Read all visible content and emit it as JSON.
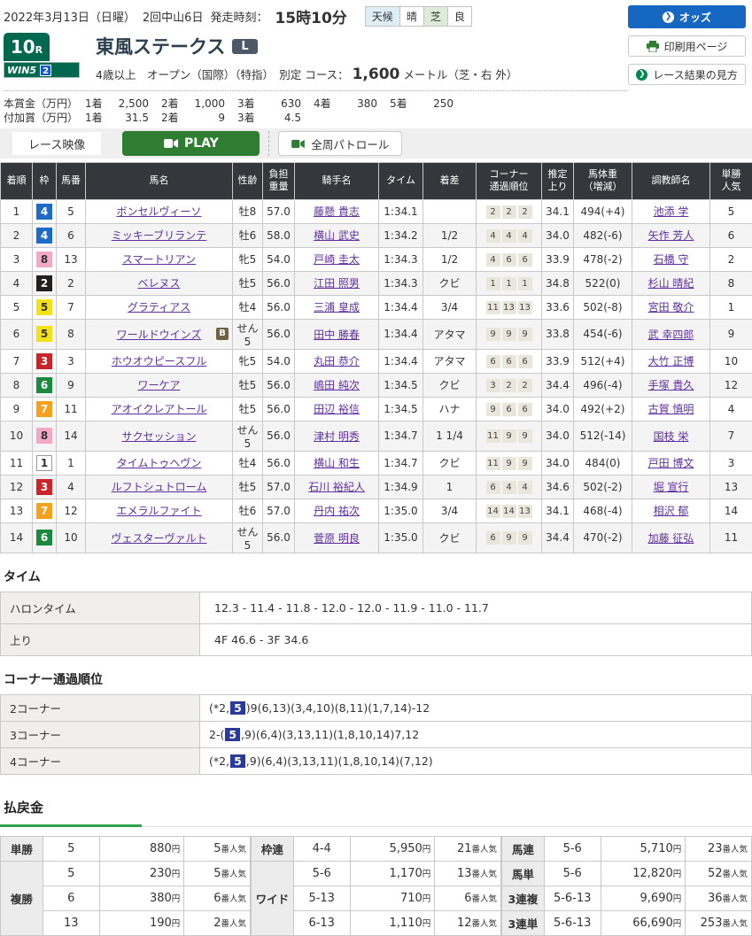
{
  "header": {
    "date": "2022年3月13日（日曜）",
    "meeting": "2回中山6日",
    "start_label": "発走時刻：",
    "start_time": "15時10分",
    "weather_label": "天候",
    "weather_value": "晴",
    "turf_label": "芝",
    "turf_value": "良",
    "buttons": {
      "odds": "オッズ",
      "print": "印刷用ページ",
      "guide": "レース結果の見方"
    }
  },
  "race": {
    "number": "10",
    "number_suffix": "R",
    "win5_label": "WIN5",
    "win5_num": "2",
    "title": "東風ステークス",
    "grade": "L",
    "conditions": "4歳以上　オープン（国際）（特指）　別定",
    "course_label": "コース：",
    "distance": "1,600",
    "course_detail": "メートル（芝・右 外）"
  },
  "prizes": {
    "main": {
      "label": "本賞金（万円）",
      "items": [
        [
          "1着",
          "2,500"
        ],
        [
          "2着",
          "1,000"
        ],
        [
          "3着",
          "630"
        ],
        [
          "4着",
          "380"
        ],
        [
          "5着",
          "250"
        ]
      ]
    },
    "added": {
      "label": "付加賞（万円）",
      "items": [
        [
          "1着",
          "31.5"
        ],
        [
          "2着",
          "9"
        ],
        [
          "3着",
          "4.5"
        ]
      ]
    }
  },
  "video": {
    "race_video": "レース映像",
    "play": "PLAY",
    "patrol": "全周パトロール"
  },
  "results": {
    "headers": [
      "着順",
      "枠",
      "馬番",
      "馬名",
      "性齢",
      "負担\n重量",
      "騎手名",
      "タイム",
      "着差",
      "コーナー\n通過順位",
      "推定\n上り",
      "馬体重\n（増減）",
      "調教師名",
      "単勝\n人気"
    ],
    "rows": [
      {
        "pos": "1",
        "frame": "4",
        "fc": "blue",
        "num": "5",
        "name": "ボンセルヴィーソ",
        "b": false,
        "sa": "牡8",
        "wt": "57.0",
        "jockey": "藤懸 貴志",
        "time": "1:34.1",
        "margin": "",
        "corners": [
          "2",
          "2",
          "2"
        ],
        "agari": "34.1",
        "bw": "494(+4)",
        "trainer": "池添 学",
        "fav": "5"
      },
      {
        "pos": "2",
        "frame": "4",
        "fc": "blue",
        "num": "6",
        "name": "ミッキーブリランテ",
        "b": false,
        "sa": "牡6",
        "wt": "58.0",
        "jockey": "横山 武史",
        "time": "1:34.2",
        "margin": "1/2",
        "corners": [
          "4",
          "4",
          "4"
        ],
        "agari": "34.0",
        "bw": "482(-6)",
        "trainer": "矢作 芳人",
        "fav": "6"
      },
      {
        "pos": "3",
        "frame": "8",
        "fc": "pink",
        "num": "13",
        "name": "スマートリアン",
        "b": false,
        "sa": "牝5",
        "wt": "54.0",
        "jockey": "戸崎 圭太",
        "time": "1:34.3",
        "margin": "1/2",
        "corners": [
          "4",
          "6",
          "6"
        ],
        "agari": "33.9",
        "bw": "478(-2)",
        "trainer": "石橋 守",
        "fav": "2"
      },
      {
        "pos": "4",
        "frame": "2",
        "fc": "black",
        "num": "2",
        "name": "ベレヌス",
        "b": false,
        "sa": "牡5",
        "wt": "56.0",
        "jockey": "江田 照男",
        "time": "1:34.3",
        "margin": "クビ",
        "corners": [
          "1",
          "1",
          "1"
        ],
        "agari": "34.8",
        "bw": "522(0)",
        "trainer": "杉山 晴紀",
        "fav": "8"
      },
      {
        "pos": "5",
        "frame": "5",
        "fc": "yellow",
        "num": "7",
        "name": "グラティアス",
        "b": false,
        "sa": "牡4",
        "wt": "56.0",
        "jockey": "三浦 皇成",
        "time": "1:34.4",
        "margin": "3/4",
        "corners": [
          "11",
          "13",
          "13"
        ],
        "agari": "33.6",
        "bw": "502(-8)",
        "trainer": "宮田 敬介",
        "fav": "1"
      },
      {
        "pos": "6",
        "frame": "5",
        "fc": "yellow",
        "num": "8",
        "name": "ワールドウインズ",
        "b": true,
        "sa": "せん5",
        "wt": "56.0",
        "jockey": "田中 勝春",
        "time": "1:34.4",
        "margin": "アタマ",
        "corners": [
          "9",
          "9",
          "9"
        ],
        "agari": "33.8",
        "bw": "454(-6)",
        "trainer": "武 幸四郎",
        "fav": "9"
      },
      {
        "pos": "7",
        "frame": "3",
        "fc": "red",
        "num": "3",
        "name": "ホウオウピースフル",
        "b": false,
        "sa": "牝5",
        "wt": "54.0",
        "jockey": "丸田 恭介",
        "time": "1:34.4",
        "margin": "アタマ",
        "corners": [
          "6",
          "6",
          "6"
        ],
        "agari": "33.9",
        "bw": "512(+4)",
        "trainer": "大竹 正博",
        "fav": "10"
      },
      {
        "pos": "8",
        "frame": "6",
        "fc": "green",
        "num": "9",
        "name": "ワーケア",
        "b": false,
        "sa": "牡5",
        "wt": "56.0",
        "jockey": "嶋田 純次",
        "time": "1:34.5",
        "margin": "クビ",
        "corners": [
          "3",
          "2",
          "2"
        ],
        "agari": "34.4",
        "bw": "496(-4)",
        "trainer": "手塚 貴久",
        "fav": "12"
      },
      {
        "pos": "9",
        "frame": "7",
        "fc": "orange",
        "num": "11",
        "name": "アオイクレアトール",
        "b": false,
        "sa": "牡5",
        "wt": "56.0",
        "jockey": "田辺 裕信",
        "time": "1:34.5",
        "margin": "ハナ",
        "corners": [
          "9",
          "6",
          "6"
        ],
        "agari": "34.0",
        "bw": "492(+2)",
        "trainer": "古賀 慎明",
        "fav": "4"
      },
      {
        "pos": "10",
        "frame": "8",
        "fc": "pink",
        "num": "14",
        "name": "サクセッション",
        "b": false,
        "sa": "せん5",
        "wt": "56.0",
        "jockey": "津村 明秀",
        "time": "1:34.7",
        "margin": "1 1/4",
        "corners": [
          "11",
          "9",
          "9"
        ],
        "agari": "34.0",
        "bw": "512(-14)",
        "trainer": "国枝 栄",
        "fav": "7"
      },
      {
        "pos": "11",
        "frame": "1",
        "fc": "white",
        "num": "1",
        "name": "タイムトゥヘヴン",
        "b": false,
        "sa": "牡4",
        "wt": "56.0",
        "jockey": "横山 和生",
        "time": "1:34.7",
        "margin": "クビ",
        "corners": [
          "11",
          "9",
          "9"
        ],
        "agari": "34.0",
        "bw": "484(0)",
        "trainer": "戸田 博文",
        "fav": "3"
      },
      {
        "pos": "12",
        "frame": "3",
        "fc": "red",
        "num": "4",
        "name": "ルフトシュトローム",
        "b": false,
        "sa": "牡5",
        "wt": "57.0",
        "jockey": "石川 裕紀人",
        "time": "1:34.9",
        "margin": "1",
        "corners": [
          "6",
          "4",
          "4"
        ],
        "agari": "34.6",
        "bw": "502(-2)",
        "trainer": "堀 宣行",
        "fav": "13"
      },
      {
        "pos": "13",
        "frame": "7",
        "fc": "orange",
        "num": "12",
        "name": "エメラルファイト",
        "b": false,
        "sa": "牡6",
        "wt": "57.0",
        "jockey": "丹内 祐次",
        "time": "1:35.0",
        "margin": "3/4",
        "corners": [
          "14",
          "14",
          "13"
        ],
        "agari": "34.1",
        "bw": "468(-4)",
        "trainer": "相沢 郁",
        "fav": "14"
      },
      {
        "pos": "14",
        "frame": "6",
        "fc": "green",
        "num": "10",
        "name": "ヴェスターヴァルト",
        "b": false,
        "sa": "せん5",
        "wt": "56.0",
        "jockey": "菅原 明良",
        "time": "1:35.0",
        "margin": "クビ",
        "corners": [
          "6",
          "9",
          "9"
        ],
        "agari": "34.4",
        "bw": "470(-2)",
        "trainer": "加藤 征弘",
        "fav": "11"
      }
    ]
  },
  "time_section": {
    "title": "タイム",
    "rows": [
      [
        "ハロンタイム",
        "12.3 - 11.4 - 11.8 - 12.0 - 12.0 - 11.9 - 11.0 - 11.7"
      ],
      [
        "上り",
        "4F 46.6 - 3F 34.6"
      ]
    ]
  },
  "corner_section": {
    "title": "コーナー通過順位",
    "rows": [
      {
        "label": "2コーナー",
        "pre": "(*2,",
        "hl": "5",
        "post": ")9(6,13)(3,4,10)(8,11)(1,7,14)-12"
      },
      {
        "label": "3コーナー",
        "pre": "2-(",
        "hl": "5",
        "post": ",9)(6,4)(3,13,11)(1,8,10,14)7,12"
      },
      {
        "label": "4コーナー",
        "pre": "(*2,",
        "hl": "5",
        "post": ",9)(6,4)(3,13,11)(1,8,10,14)(7,12)"
      }
    ]
  },
  "payouts": {
    "title": "払戻金",
    "yen_suffix": "円",
    "pop_suffix": "番人気",
    "groups": [
      [
        {
          "label": "単勝",
          "rows": [
            [
              "5",
              "880",
              "5"
            ]
          ]
        },
        {
          "label": "複勝",
          "rows": [
            [
              "5",
              "230",
              "5"
            ],
            [
              "6",
              "380",
              "6"
            ],
            [
              "13",
              "190",
              "2"
            ]
          ]
        }
      ],
      [
        {
          "label": "枠連",
          "rows": [
            [
              "4-4",
              "5,950",
              "21"
            ]
          ]
        },
        {
          "label": "ワイド",
          "rows": [
            [
              "5-6",
              "1,170",
              "13"
            ],
            [
              "5-13",
              "710",
              "6"
            ],
            [
              "6-13",
              "1,110",
              "12"
            ]
          ]
        }
      ],
      [
        {
          "label": "馬連",
          "rows": [
            [
              "5-6",
              "5,710",
              "23"
            ]
          ]
        },
        {
          "label": "馬単",
          "rows": [
            [
              "5-6",
              "12,820",
              "52"
            ]
          ]
        },
        {
          "label": "3連複",
          "rows": [
            [
              "5-6-13",
              "9,690",
              "36"
            ]
          ]
        },
        {
          "label": "3連単",
          "rows": [
            [
              "5-6-13",
              "66,690",
              "253"
            ]
          ]
        }
      ]
    ]
  }
}
